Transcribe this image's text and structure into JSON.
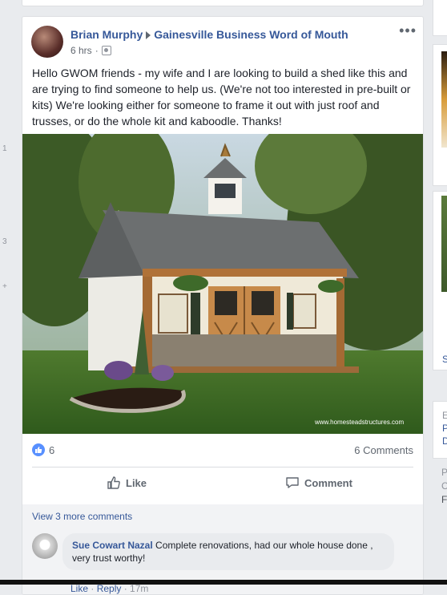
{
  "left_rail": {
    "numbers": [
      "1",
      "3",
      "+"
    ]
  },
  "post": {
    "author": "Brian Murphy",
    "group": "Gainesville Business Word of Mouth",
    "time": "6 hrs",
    "more": "•••",
    "text": "Hello GWOM friends - my wife and I are looking to build a shed like this and are trying to find someone to help us. (We're not too interested in pre-built or kits) We're looking either for someone to frame it out with just roof and trusses, or do the whole kit and kaboodle. Thanks!",
    "image_watermark": "www.homesteadstructures.com",
    "like_count": "6",
    "comments_count": "6 Comments",
    "like_label": "Like",
    "comment_label": "Comment",
    "view_more": "View 3 more comments"
  },
  "comment": {
    "author": "Sue Cowart Nazal",
    "text": "Complete renovations, had our whole house done , very trust worthy!",
    "like": "Like",
    "reply": "Reply",
    "time": "17m",
    "sep": " · "
  },
  "right_col": {
    "letters": [
      "S",
      "E",
      "P",
      "D",
      "P",
      "C",
      "F"
    ]
  },
  "colors": {
    "link": "#365899",
    "like_blue": "#5890ff",
    "bg": "#e9ebee"
  }
}
